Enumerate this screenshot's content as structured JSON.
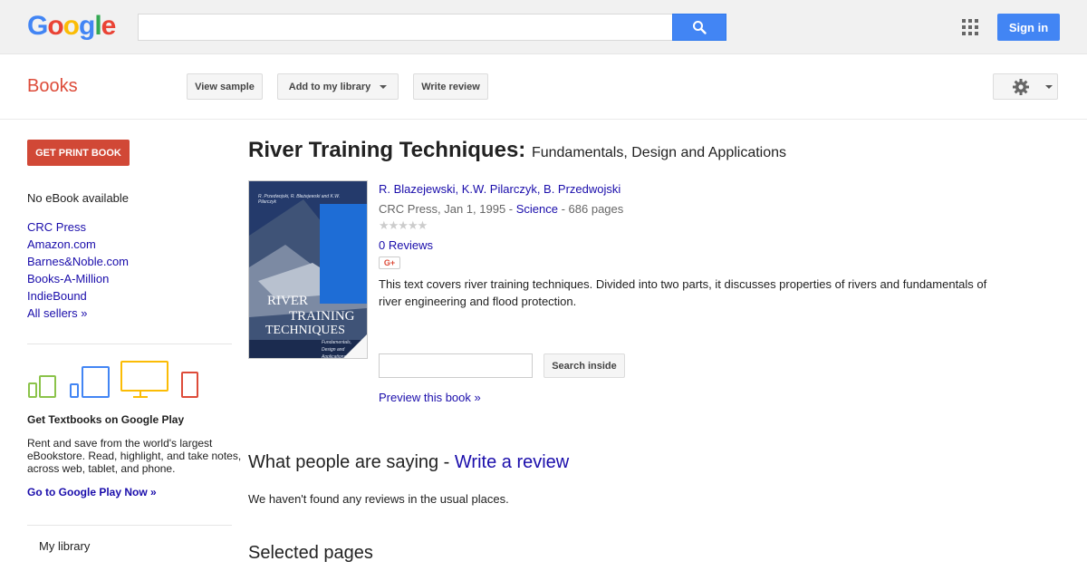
{
  "header": {
    "logo": [
      "G",
      "o",
      "o",
      "g",
      "l",
      "e"
    ],
    "logo_colors": [
      "#4285f4",
      "#ea4335",
      "#fbbc05",
      "#4285f4",
      "#34a853",
      "#ea4335"
    ],
    "search_value": "",
    "sign_in": "Sign in"
  },
  "subbar": {
    "title": "Books",
    "view_sample": "View sample",
    "add_library": "Add to my library",
    "write_review": "Write review"
  },
  "sidebar": {
    "get_print": "GET PRINT BOOK",
    "no_ebook": "No eBook available",
    "sellers": [
      "CRC Press",
      "Amazon.com",
      "Barnes&Noble.com",
      "Books-A-Million",
      "IndieBound",
      "All sellers »"
    ],
    "textbooks_title": "Get Textbooks on Google Play",
    "textbooks_text": "Rent and save from the world's largest eBookstore. Read, highlight, and take notes, across web, tablet, and phone.",
    "textbooks_link": "Go to Google Play Now »",
    "my_library": "My library"
  },
  "book": {
    "title": "River Training Techniques:",
    "subtitle": "Fundamentals, Design and Applications",
    "authors": "R. Blazejewski, K.W. Pilarczyk, B. Przedwojski",
    "publisher_date": "CRC Press, Jan 1, 1995 - ",
    "category": "Science",
    "pages": " - 686 pages",
    "stars": "★★★★★",
    "reviews": "0 Reviews",
    "gplus": "G+",
    "description": "This text covers river training techniques. Divided into two parts, it discusses properties of rivers and fundamentals of river engineering and flood protection.",
    "cover_authors": "R. Przedwojski, R. Błażejewski and K.W. Pilarczyk",
    "cover_title_1": "River",
    "cover_title_2": "Training",
    "cover_title_3": "Techniques",
    "cover_sub": "Fundamentals, Design and Applications"
  },
  "search_inside": {
    "value": "",
    "button": "Search inside"
  },
  "preview": "Preview this book »",
  "reviews_section": {
    "prefix": "What people are saying - ",
    "link": "Write a review",
    "empty": "We haven't found any reviews in the usual places."
  },
  "selected_pages": "Selected pages"
}
